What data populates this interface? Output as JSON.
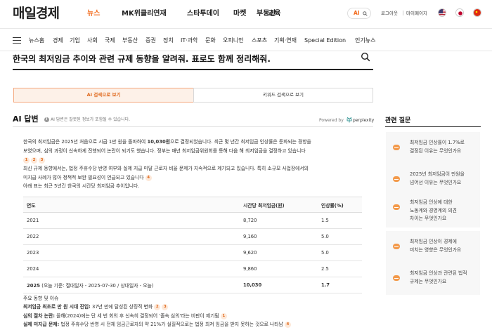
{
  "header": {
    "logo": "매일경제",
    "nav": [
      "뉴스",
      "MK위클리연재",
      "스타투데이",
      "마켓",
      "부동산",
      "교육"
    ],
    "ai_toggle": "AI",
    "links": [
      "로그아웃",
      "마이페이지"
    ]
  },
  "menu": {
    "items": [
      "뉴스홈",
      "경제",
      "기업",
      "사회",
      "국제",
      "부동산",
      "증권",
      "정치",
      "IT·과학",
      "문화",
      "오피니언",
      "스포츠",
      "기획·연재",
      "Special Edition",
      "인기뉴스"
    ]
  },
  "question": "한국의 최저임금 추이와 관련 규제 동향을 알려줘. 표로도 함께 정리해줘.",
  "tabs": {
    "ai": "AI 검색으로 보기",
    "keyword": "키워드 검색으로 보기"
  },
  "answer": {
    "title": "AI 답변",
    "note": "AI 답변은 잘못된 정보가 포함될 수 있습니다.",
    "powered_by": "Powered by",
    "provider": "perplexity",
    "p1": {
      "l1a": "한국의 최저임금은 2025년 처음으로 시급 1만 원을 돌파하여 ",
      "l1b": "10,030원",
      "l1c": "으로 결정되었습니다. 최근 몇 년간 최저임금 인상률은 둔화되는 경향을",
      "l2": "보였으며, 심의 과정이 신속하게 진행되어 논란이 되기도 했습니다. 정부는 매년 최저임금위원회를 통해 다음 해 최저임금을 결정하고 있습니다",
      "cites": [
        "1",
        "2",
        "3"
      ]
    },
    "p2": {
      "l1": "최신 규제 동향에서는, 법정 주휴수당 반영 여부와 실제 지급 미달 근로자 비율 문제가 지속적으로 제기되고 있습니다. 특히 소규모 사업장에서의",
      "l2": "미지급 사례가 많아 정책적 보완 필요성이 언급되고 있습니다",
      "cite": "4"
    },
    "p3": "아래 표는 최근 5년간 한국의 시간당 최저임금 추이입니다."
  },
  "table": {
    "headers": [
      "연도",
      "시간당 최저임금(원)",
      "인상률(%)"
    ],
    "rows": [
      {
        "year": "2021",
        "wage": "8,720",
        "rate": "1.5"
      },
      {
        "year": "2022",
        "wage": "9,160",
        "rate": "5.0"
      },
      {
        "year": "2023",
        "wage": "9,620",
        "rate": "5.0"
      },
      {
        "year": "2024",
        "wage": "9,860",
        "rate": "2.5"
      }
    ],
    "last": {
      "year": "2025",
      "year_note": "(오늘 기준: 절대일자 - 2025-07-30 / 상대일자 - 오늘)",
      "wage": "10,030",
      "rate": "1.7"
    }
  },
  "issues": {
    "heading": "주요 동향 및 이슈",
    "i1_label": "최저임금 최초로 만 원 시대 진입:",
    "i1_text": " 37년 만에 달성된 상징적 변화",
    "i1_cites": [
      "2",
      "3"
    ],
    "i2_label": "심의 절차 논란:",
    "i2_text": " 올해(2024)에는 단 세 번 회의 후 신속히 결정되어 '졸속 심의'라는 비판이 제기됨",
    "i2_cite": "1",
    "i3_label": "실제 미지급 문제:",
    "i3_text": " 법정 주휴수당 반영 시 전체 임금근로자의 약 21%가 실질적으로는 법정 최저 임금을 받지 못하는 것으로 나타남",
    "i3_cite": "4"
  },
  "related": {
    "title": "관련 질문",
    "items": [
      [
        "최저임금 인상률이 1.7%로",
        "결정된 이유는 무엇인가요"
      ],
      [
        "2025년 최저임금이 만원을",
        "넘어선 이유는 무엇인가요"
      ],
      [
        "최저임금 인상에 대한",
        "노동계와 경영계의 의견",
        "차이는 무엇인가요"
      ],
      [
        "최저임금 인상이 경제에",
        "미치는 영향은 무엇인가요"
      ],
      [
        "최저임금 인상과 관련된 법적",
        "규제는 무엇인가요"
      ]
    ]
  },
  "colors": {
    "accent": "#f26b1d",
    "cite_bg": "#fde8d8"
  }
}
